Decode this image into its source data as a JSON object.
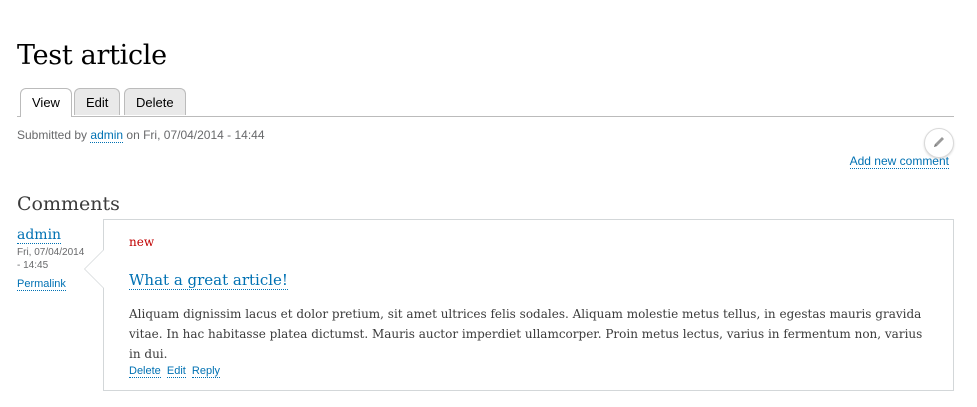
{
  "node": {
    "title": "Test article",
    "tabs": [
      {
        "label": "View",
        "active": true
      },
      {
        "label": "Edit",
        "active": false
      },
      {
        "label": "Delete",
        "active": false
      }
    ],
    "submitted": {
      "prefix": "Submitted by",
      "author": "admin",
      "suffix": "on Fri, 07/04/2014 - 14:44"
    },
    "contextual_icon": "pencil-icon",
    "add_comment_label": "Add new comment"
  },
  "comments": {
    "heading": "Comments",
    "items": [
      {
        "author": "admin",
        "date": "Fri, 07/04/2014 - 14:45",
        "permalink_label": "Permalink",
        "new_marker": "new",
        "title": "What a great article!",
        "body": "Aliquam dignissim lacus et dolor pretium, sit amet ultrices felis sodales. Aliquam molestie metus tellus, in egestas mauris gravida vitae. In hac habitasse platea dictumst. Mauris auctor imperdiet ullamcorper. Proin metus lectus, varius in fermentum non, varius in dui.",
        "links": {
          "delete": "Delete",
          "edit": "Edit",
          "reply": "Reply"
        }
      }
    ]
  },
  "colors": {
    "link": "#0071b3",
    "new_marker": "#c00000",
    "meta_text": "#68696b"
  }
}
